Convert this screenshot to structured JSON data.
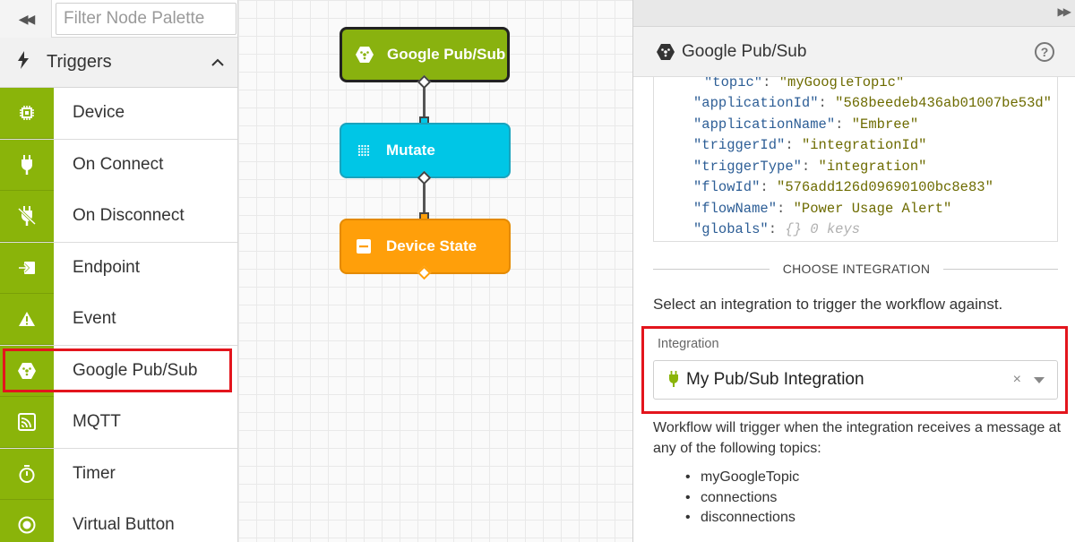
{
  "palette": {
    "collapse_glyph": "◀◀",
    "filter_placeholder": "Filter Node Palette",
    "section": {
      "title": "Triggers",
      "icon": "bolt-icon",
      "toggle_icon": "chevron-up-icon"
    },
    "items": [
      {
        "label": "Device",
        "icon": "chip-icon"
      },
      {
        "label": "On Connect",
        "icon": "plug-icon"
      },
      {
        "label": "On Disconnect",
        "icon": "unplug-icon"
      },
      {
        "label": "Endpoint",
        "icon": "endpoint-icon"
      },
      {
        "label": "Event",
        "icon": "warning-icon"
      },
      {
        "label": "Google Pub/Sub",
        "icon": "google-pubsub-icon",
        "highlighted": true
      },
      {
        "label": "MQTT",
        "icon": "mqtt-icon"
      },
      {
        "label": "Timer",
        "icon": "stopwatch-icon"
      },
      {
        "label": "Virtual Button",
        "icon": "radio-button-icon"
      }
    ],
    "accent_color": "#8ab40a"
  },
  "canvas": {
    "nodes": [
      {
        "label": "Google Pub/Sub",
        "color": "#89b20f",
        "icon": "google-pubsub-icon"
      },
      {
        "label": "Mutate",
        "color": "#00c6e6",
        "icon": "grid-dots-icon"
      },
      {
        "label": "Device State",
        "color": "#ff9f0a",
        "icon": "minus-square-icon"
      }
    ]
  },
  "panel": {
    "collapse_glyph": "▶▶",
    "title": "Google Pub/Sub",
    "title_icon": "google-pubsub-icon",
    "help_glyph": "?",
    "json_lines": [
      {
        "key": "\"topic\"",
        "value": "\"myGoogleTopic\""
      },
      {
        "key": "\"applicationId\"",
        "value": "\"568beedeb436ab01007be53d\""
      },
      {
        "key": "\"applicationName\"",
        "value": "\"Embree\""
      },
      {
        "key": "\"triggerId\"",
        "value": "\"integrationId\""
      },
      {
        "key": "\"triggerType\"",
        "value": "\"integration\""
      },
      {
        "key": "\"flowId\"",
        "value": "\"576add126d09690100bc8e83\""
      },
      {
        "key": "\"flowName\"",
        "value": "\"Power Usage Alert\""
      },
      {
        "key": "\"globals\"",
        "meta": "{} 0 keys"
      }
    ],
    "choose_heading": "CHOOSE INTEGRATION",
    "select_intro": "Select an integration to trigger the workflow against.",
    "integration": {
      "label": "Integration",
      "selected": "My Pub/Sub Integration",
      "clear_glyph": "×"
    },
    "trigger_note": "Workflow will trigger when the integration receives a message at any of the following topics:",
    "topics": [
      "myGoogleTopic",
      "connections",
      "disconnections"
    ],
    "highlight_color": "#e3151d"
  }
}
